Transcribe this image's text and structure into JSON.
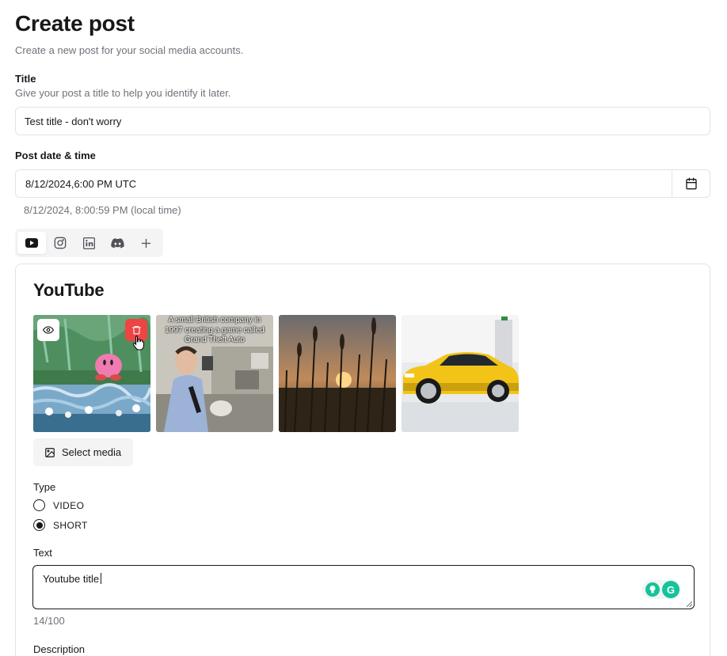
{
  "page": {
    "title": "Create post",
    "subtitle": "Create a new post for your social media accounts."
  },
  "title_field": {
    "label": "Title",
    "help": "Give your post a title to help you identify it later.",
    "value": "Test title - don't worry"
  },
  "post_date": {
    "label": "Post date & time",
    "value": "8/12/2024,6:00 PM UTC",
    "local_time": "8/12/2024, 8:00:59 PM (local time)",
    "calendar_icon": "calendar-icon"
  },
  "platform_tabs": [
    {
      "name": "youtube",
      "icon": "youtube-icon",
      "active": true
    },
    {
      "name": "instagram",
      "icon": "instagram-icon",
      "active": false
    },
    {
      "name": "linkedin",
      "icon": "linkedin-icon",
      "active": false
    },
    {
      "name": "discord",
      "icon": "discord-icon",
      "active": false
    },
    {
      "name": "add",
      "icon": "plus-icon",
      "active": false
    }
  ],
  "youtube_card": {
    "title": "YouTube",
    "media": [
      {
        "kind": "kirby-painting",
        "caption": ""
      },
      {
        "kind": "reporter-office",
        "caption": "A small British company in 1997 creating a game called Grand Theft Auto"
      },
      {
        "kind": "sunset-grass",
        "caption": ""
      },
      {
        "kind": "yellow-car",
        "caption": ""
      }
    ],
    "select_media_label": "Select media",
    "type_label": "Type",
    "type_options": [
      {
        "label": "VIDEO",
        "selected": false
      },
      {
        "label": "SHORT",
        "selected": true
      }
    ],
    "text_label": "Text",
    "text_value": "Youtube title",
    "char_count": "14/100",
    "description_label": "Description"
  },
  "colors": {
    "accent": "#18181b",
    "muted": "#71717a",
    "border": "#e4e4e7",
    "danger": "#ef4444",
    "grammarly": "#15c39a"
  }
}
